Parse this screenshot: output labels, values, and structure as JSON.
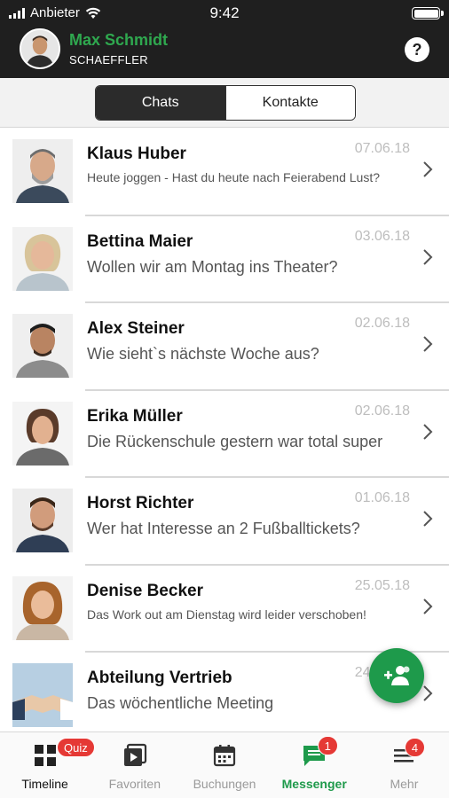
{
  "status": {
    "carrier": "Anbieter",
    "time": "9:42"
  },
  "profile": {
    "name": "Max Schmidt",
    "company": "SCHAEFFLER"
  },
  "help_label": "?",
  "segments": {
    "chats": "Chats",
    "contacts": "Kontakte"
  },
  "chats": [
    {
      "name": "Klaus Huber",
      "date": "07.06.18",
      "message": "Heute joggen - Hast du heute nach Feierabend Lust?"
    },
    {
      "name": "Bettina Maier",
      "date": "03.06.18",
      "message": "Wollen wir am Montag ins Theater?"
    },
    {
      "name": "Alex Steiner",
      "date": "02.06.18",
      "message": "Wie sieht`s nächste Woche aus?"
    },
    {
      "name": "Erika Müller",
      "date": "02.06.18",
      "message": "Die Rückenschule gestern war total super"
    },
    {
      "name": "Horst Richter",
      "date": "01.06.18",
      "message": "Wer hat Interesse an 2 Fußballtickets?"
    },
    {
      "name": "Denise Becker",
      "date": "25.05.18",
      "message": "Das Work out am Dienstag wird leider verschoben!"
    },
    {
      "name": "Abteilung Vertrieb",
      "date": "24.05.18",
      "message": "Das wöchentliche Meeting"
    }
  ],
  "tabs": {
    "timeline": {
      "label": "Timeline",
      "badge": "Quiz"
    },
    "favoriten": {
      "label": "Favoriten"
    },
    "buchungen": {
      "label": "Buchungen"
    },
    "messenger": {
      "label": "Messenger",
      "badge": "1"
    },
    "mehr": {
      "label": "Mehr",
      "badge": "4"
    }
  },
  "colors": {
    "accent": "#1e9a4b",
    "header": "#1f1f1f",
    "badge": "#e53935"
  }
}
